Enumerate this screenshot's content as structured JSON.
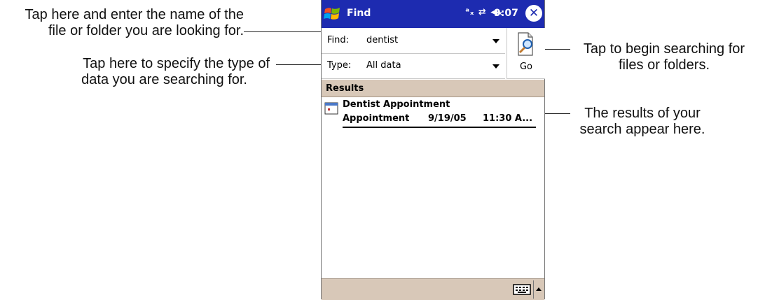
{
  "callouts": {
    "find_line1": "Tap here and enter the name of the",
    "find_line2": "file or folder you are looking for.",
    "type_line1": "Tap here to specify the type of",
    "type_line2": "data you are searching for.",
    "go_line1": "Tap to begin searching for",
    "go_line2": "files or folders.",
    "results_line1": "The results of your",
    "results_line2": "search appear here."
  },
  "titlebar": {
    "title": "Find",
    "status_icons": "ᵃₓ ⇄ ◀ₓ",
    "time": "9:07",
    "close_symbol": "✕",
    "color": "#1d2bb0"
  },
  "form": {
    "find_label": "Find:",
    "find_value": "dentist",
    "type_label": "Type:",
    "type_value": "All data",
    "go_label": "Go"
  },
  "results": {
    "header": "Results",
    "items": [
      {
        "title": "Dentist Appointment",
        "category": "Appointment",
        "date": "9/19/05",
        "time": "11:30 A..."
      }
    ]
  },
  "icons": {
    "start": "windows-flag-icon",
    "go": "magnifier-document-icon",
    "result": "calendar-icon",
    "keyboard": "keyboard-icon"
  },
  "colors": {
    "accent": "#1d2bb0",
    "bar": "#d8c8b8"
  }
}
